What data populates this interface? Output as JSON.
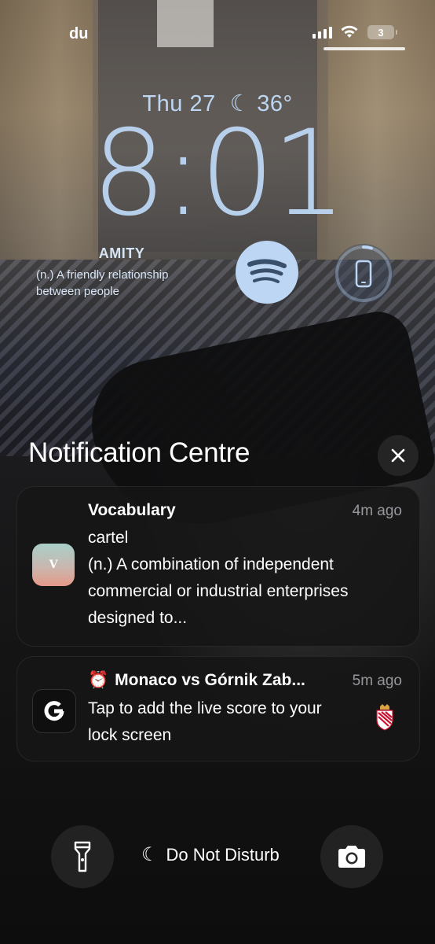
{
  "status_bar": {
    "carrier": "du",
    "battery_level": "3"
  },
  "lock_screen": {
    "date": "Thu 27",
    "temperature": "36°",
    "time": "8:01"
  },
  "widgets": {
    "vocabulary": {
      "word": "AMITY",
      "definition": "(n.) A friendly relationship between people"
    },
    "spotify_icon": "spotify-icon",
    "device_icon": "phone-icon"
  },
  "notification_centre": {
    "title": "Notification Centre",
    "notifications": [
      {
        "app_icon_letter": "V",
        "title": "Vocabulary",
        "time": "4m ago",
        "body": "cartel\n(n.) A combination of independent commercial or industrial enterprises designed to..."
      },
      {
        "title_emoji": "⏰",
        "title": "Monaco vs Górnik Zab...",
        "time": "5m ago",
        "body": "Tap to add the live score to your lock screen"
      }
    ]
  },
  "bottom_controls": {
    "focus_label": "Do Not Disturb"
  },
  "colors": {
    "clock": "#bcd6f3",
    "notification_bg": "#161616"
  }
}
